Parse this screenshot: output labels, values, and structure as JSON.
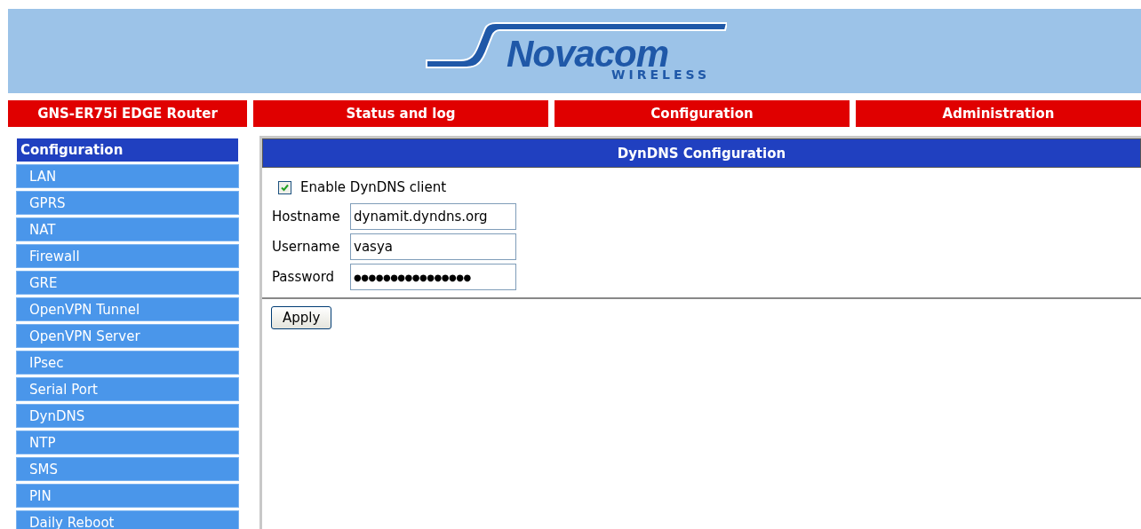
{
  "logo": {
    "name": "Novacom",
    "tagline": "WIRELESS"
  },
  "nav": [
    {
      "label": "GNS-ER75i EDGE Router"
    },
    {
      "label": "Status and log"
    },
    {
      "label": "Configuration"
    },
    {
      "label": "Administration"
    }
  ],
  "sidebar": {
    "title": "Configuration",
    "items": [
      "LAN",
      "GPRS",
      "NAT",
      "Firewall",
      "GRE",
      "OpenVPN Tunnel",
      "OpenVPN Server",
      "IPsec",
      "Serial Port",
      "DynDNS",
      "NTP",
      "SMS",
      "PIN",
      "Daily Reboot"
    ]
  },
  "panel": {
    "title": "DynDNS Configuration",
    "enable": {
      "label": "Enable DynDNS client",
      "checked": true
    },
    "fields": [
      {
        "label": "Hostname",
        "value": "dynamit.dyndns.org"
      },
      {
        "label": "Username",
        "value": "vasya"
      },
      {
        "label": "Password",
        "kind": "password",
        "value": "●●●●●●●●●●●●●●●●"
      }
    ],
    "button": "Apply"
  }
}
